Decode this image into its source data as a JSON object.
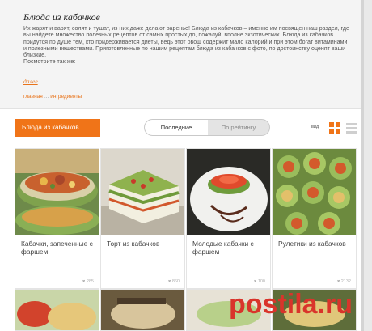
{
  "header": {
    "title": "Блюда из кабачков",
    "description": "Их жарят и варят, солят и тушат, из них даже делают варенье! Блюда из кабачков – именно им посвящен наш раздел, где вы найдете множество полезных рецептов от самых простых до, пожалуй, вполне экзотических. Блюда из кабачков придутся по душе тем, кто придерживается диеты, ведь этот овощ содержит мало калорий и при этом богат витаминами и полезными веществами. Приготовленные по нашим рецептам блюда из кабачков с фото, по достоинству оценят ваши близкие.",
    "description_tail": "Посмотрите так же:",
    "more_label": "далее",
    "breadcrumb": [
      "главная",
      "...",
      "ингредиенты"
    ]
  },
  "toolbar": {
    "category_label": "Блюда из кабачков",
    "sort_options": [
      "Последние",
      "По рейтингу"
    ],
    "active_sort": "Последние",
    "view_label": "вид",
    "active_view": "grid",
    "accent_color": "#f07418"
  },
  "recipes": [
    {
      "title": "Кабачки, запеченные с фаршем",
      "likes": "285"
    },
    {
      "title": "Торт из кабачков",
      "likes": "860"
    },
    {
      "title": "Молодые кабачки с фаршем",
      "likes": "100"
    },
    {
      "title": "Рулетики из кабачков",
      "likes": "2132"
    }
  ],
  "watermark": {
    "text": "postila",
    "dot": ".",
    "tld": "ru",
    "color": "#d9342b"
  }
}
